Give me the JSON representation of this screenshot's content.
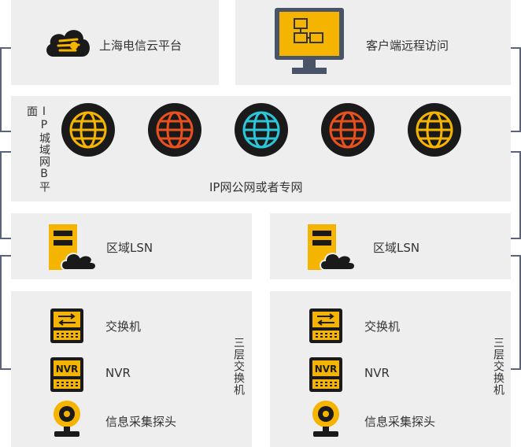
{
  "top": {
    "cloud_label": "上海电信云平台",
    "remote_label": "客户端远程访问"
  },
  "network": {
    "side_label": "IP城域网B平面",
    "bottom_label": "IP网公网或者专网",
    "globes": [
      {
        "color": "#f5b400"
      },
      {
        "color": "#e8501e"
      },
      {
        "color": "#2cc6d8"
      },
      {
        "color": "#e8501e"
      },
      {
        "color": "#f5b400"
      }
    ]
  },
  "left": {
    "lsn_label": "区域LSN",
    "switch_label": "交换机",
    "nvr_label": "NVR",
    "camera_label": "信息采集探头",
    "side_label": "三层交换机"
  },
  "right": {
    "lsn_label": "区域LSN",
    "switch_label": "交换机",
    "nvr_label": "NVR",
    "camera_label": "信息采集探头",
    "side_label": "三层交换机"
  },
  "colors": {
    "panel": "#eeeeee",
    "accent": "#f5b400",
    "dark": "#1a1a1a",
    "bracket": "#5a6478"
  },
  "icons": {
    "nvr_text": "NVR"
  }
}
